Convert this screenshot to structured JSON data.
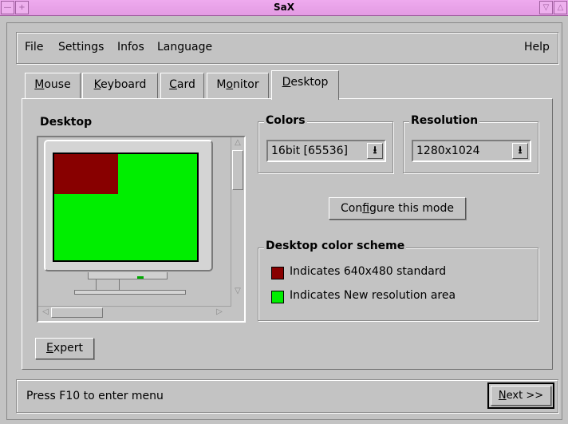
{
  "window": {
    "title": "SaX"
  },
  "menu": {
    "file": "File",
    "settings": "Settings",
    "infos": "Infos",
    "language": "Language",
    "help": "Help"
  },
  "tabs": [
    {
      "pre": "",
      "ul": "M",
      "post": "ouse"
    },
    {
      "pre": "",
      "ul": "K",
      "post": "eyboard"
    },
    {
      "pre": "",
      "ul": "C",
      "post": "ard"
    },
    {
      "pre": "M",
      "ul": "o",
      "post": "nitor"
    },
    {
      "pre": "",
      "ul": "D",
      "post": "esktop"
    }
  ],
  "desktop": {
    "heading": "Desktop"
  },
  "colors": {
    "heading": "Colors",
    "value": "16bit [65536]"
  },
  "resolution": {
    "heading": "Resolution",
    "value": "1280x1024"
  },
  "configure_button": {
    "pre": "Con",
    "ul": "f",
    "post": "igure this mode"
  },
  "scheme": {
    "heading": "Desktop color scheme",
    "items": [
      {
        "color": "#880000",
        "label": "Indicates 640x480 standard"
      },
      {
        "color": "#00ee00",
        "label": "Indicates New resolution area"
      }
    ]
  },
  "expert_button": {
    "ul": "E",
    "post": "xpert"
  },
  "status": {
    "text": "Press F10 to enter menu"
  },
  "next_button": {
    "ul": "N",
    "post": "ext >>"
  }
}
